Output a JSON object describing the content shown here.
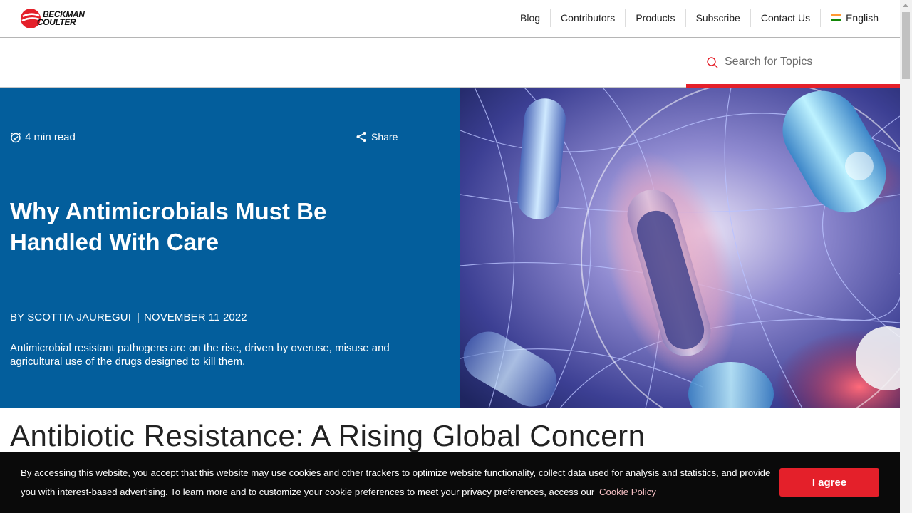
{
  "brand": {
    "logo_line1": "BECKMAN",
    "logo_line2": "COULTER"
  },
  "nav": {
    "items": [
      "Blog",
      "Contributors",
      "Products",
      "Subscribe",
      "Contact Us"
    ],
    "language": "English"
  },
  "search": {
    "placeholder": "Search for Topics"
  },
  "hero": {
    "read_time": "4 min read",
    "share_label": "Share",
    "title": "Why Antimicrobials Must Be Handled With Care",
    "author": "BY SCOTTIA JAUREGUI",
    "date": "NOVEMBER 11 2022",
    "summary": "Antimicrobial resistant pathogens are on the rise, driven by overuse, misuse and agricultural use of the drugs designed to kill them."
  },
  "article": {
    "heading": "Antibiotic Resistance: A Rising Global Concern"
  },
  "cookie": {
    "text": "By accessing this website, you accept that this website may use cookies and other trackers to optimize website functionality, collect data used for analysis and statistics, and provide you with interest-based advertising. To learn more and to customize your cookie preferences to meet your privacy preferences, access our",
    "link": "Cookie Policy",
    "button": "I agree"
  },
  "colors": {
    "hero_bg": "#035e9c",
    "accent": "#e4202a",
    "banner_bg": "#0a0a0a"
  }
}
